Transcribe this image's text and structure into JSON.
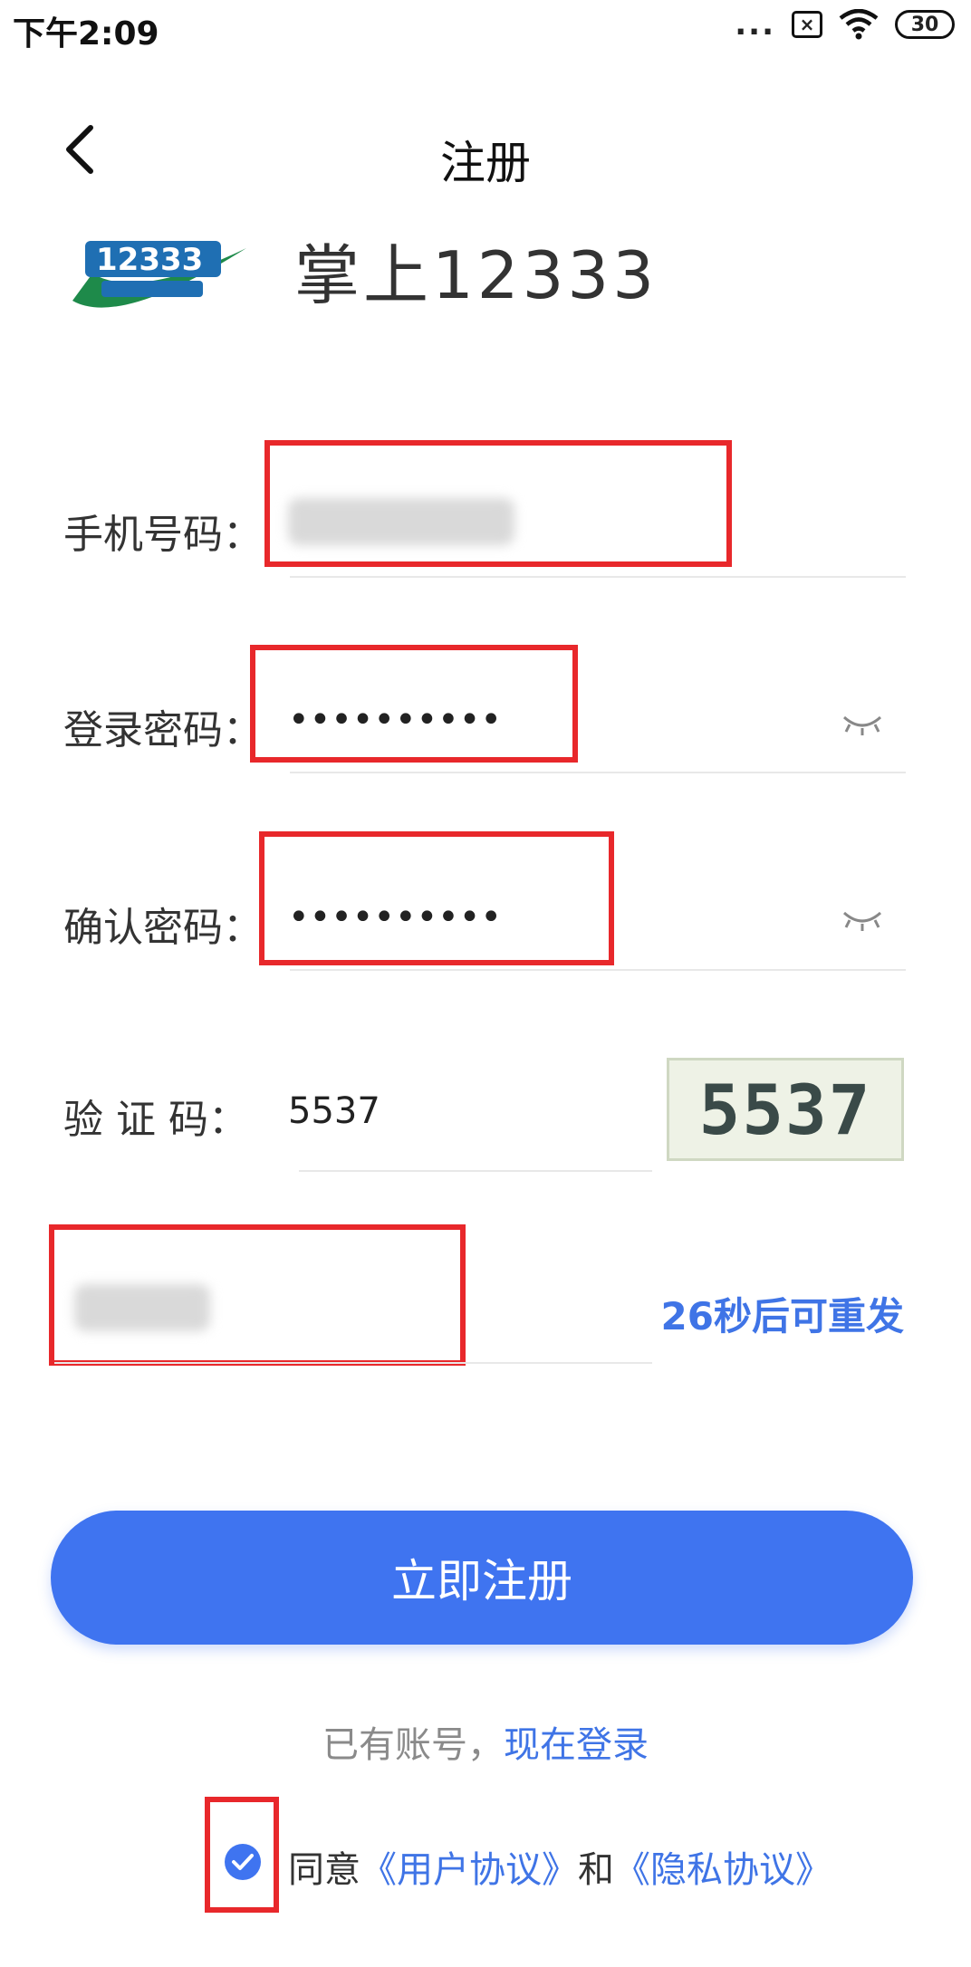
{
  "status_bar": {
    "time": "下午2:09",
    "dots": "...",
    "sim": "×",
    "battery": "30"
  },
  "nav": {
    "title": "注册"
  },
  "brand": {
    "name": "掌上12333",
    "logo_text": "12333"
  },
  "form": {
    "phone": {
      "label": "手机号码："
    },
    "password": {
      "label": "登录密码：",
      "value": "••••••••••"
    },
    "confirm": {
      "label": "确认密码：",
      "value": "••••••••••"
    },
    "captcha": {
      "label": "验  证  码：",
      "value": "5537",
      "image_text": "5537"
    },
    "sms": {
      "resend": "26秒后可重发"
    }
  },
  "actions": {
    "register": "立即注册"
  },
  "login": {
    "prefix": "已有账号，",
    "link": "现在登录"
  },
  "agreement": {
    "prefix": "同意",
    "user": "《用户协议》",
    "and": "和",
    "privacy": "《隐私协议》"
  },
  "colors": {
    "accent": "#3f74f0",
    "annotation": "#e8282b"
  }
}
